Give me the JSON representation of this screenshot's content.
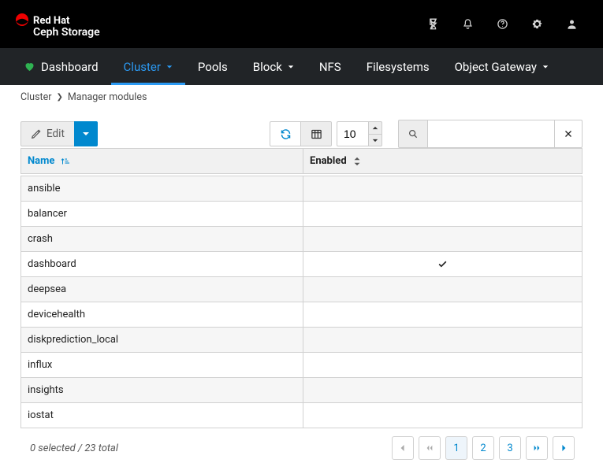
{
  "brand": {
    "top": "Red Hat",
    "sub": "Ceph Storage"
  },
  "nav": {
    "dashboard": "Dashboard",
    "cluster": "Cluster",
    "pools": "Pools",
    "block": "Block",
    "nfs": "NFS",
    "filesystems": "Filesystems",
    "object_gateway": "Object Gateway"
  },
  "breadcrumb": {
    "root": "Cluster",
    "leaf": "Manager modules"
  },
  "toolbar": {
    "edit_label": "Edit",
    "page_size": "10",
    "search_value": ""
  },
  "table": {
    "headers": {
      "name": "Name",
      "enabled": "Enabled"
    },
    "rows": [
      {
        "name": "ansible",
        "enabled": false
      },
      {
        "name": "balancer",
        "enabled": false
      },
      {
        "name": "crash",
        "enabled": false
      },
      {
        "name": "dashboard",
        "enabled": true
      },
      {
        "name": "deepsea",
        "enabled": false
      },
      {
        "name": "devicehealth",
        "enabled": false
      },
      {
        "name": "diskprediction_local",
        "enabled": false
      },
      {
        "name": "influx",
        "enabled": false
      },
      {
        "name": "insights",
        "enabled": false
      },
      {
        "name": "iostat",
        "enabled": false
      }
    ]
  },
  "footer": {
    "status": "0 selected / 23 total"
  },
  "pagination": {
    "pages": [
      "1",
      "2",
      "3"
    ],
    "current": 0
  }
}
